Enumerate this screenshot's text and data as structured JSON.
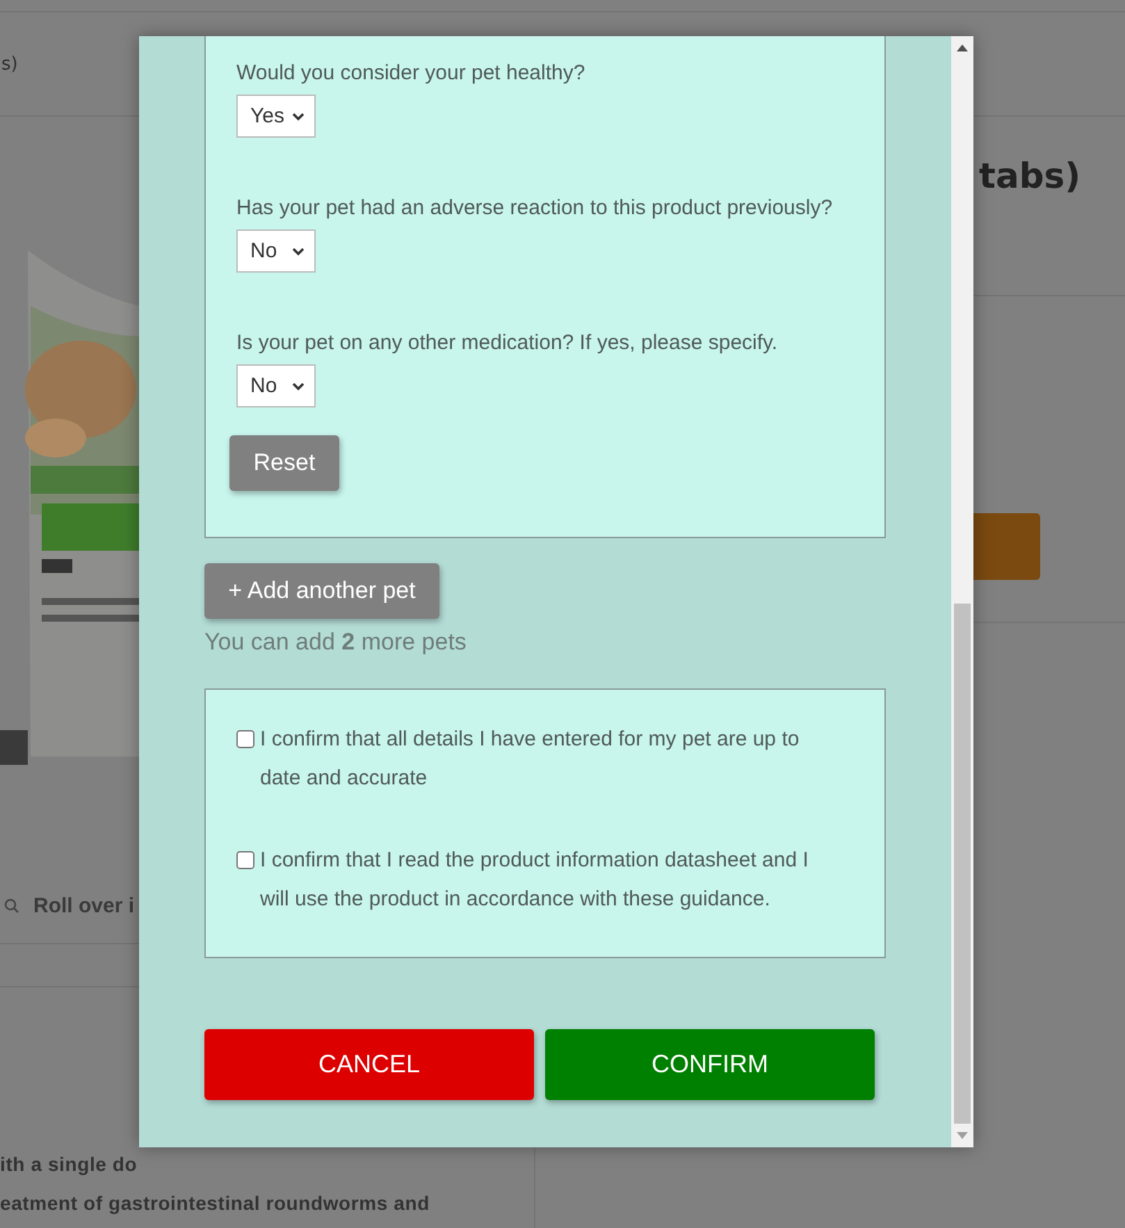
{
  "background_page": {
    "header_text": "s)",
    "product_title": "tabs)",
    "zoom_hint": "Roll over i",
    "description_lines": [
      "ith a single do",
      "eatment of gastrointestinal roundworms and"
    ]
  },
  "modal": {
    "questions": [
      {
        "label": "Would you consider your pet healthy?",
        "value": "Yes"
      },
      {
        "label": "Has your pet had an adverse reaction to this product previously?",
        "value": "No"
      },
      {
        "label": "Is your pet on any other medication? If yes, please specify.",
        "value": "No"
      }
    ],
    "reset_button": "Reset",
    "add_pet_button": "+ Add another pet",
    "remaining_note": "You can add **2** more pets",
    "confirmations": [
      {
        "label": "I confirm that all details I have entered for my pet are up to date and accurate",
        "checked": false
      },
      {
        "label": "I confirm that I read the product information datasheet and I will use the product in accordance with these guidance.",
        "checked": false
      }
    ],
    "buttons": [
      {
        "label": "CANCEL",
        "kind": "cancel"
      },
      {
        "label": "CONFIRM",
        "kind": "confirm"
      }
    ]
  }
}
